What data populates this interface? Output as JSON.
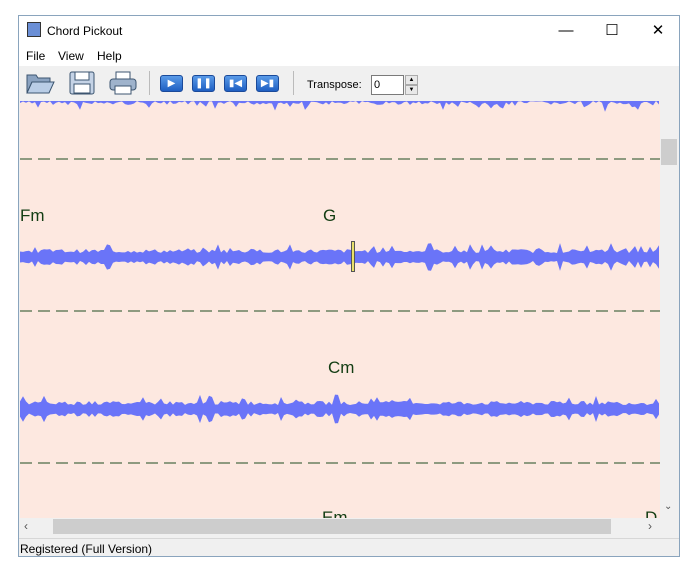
{
  "window": {
    "title": "Chord Pickout",
    "icons": {
      "minimize": "minimize-icon",
      "maximize": "maximize-icon",
      "close": "close-icon"
    }
  },
  "menu": [
    "File",
    "View",
    "Help"
  ],
  "toolbar": {
    "transpose_label": "Transpose:",
    "transpose_value": "0",
    "buttons": [
      "open-folder-icon",
      "save-icon",
      "print-icon",
      "play-icon",
      "pause-icon",
      "previous-icon",
      "next-icon"
    ]
  },
  "chords": [
    {
      "label": "Fm"
    },
    {
      "label": "G"
    },
    {
      "label": "Cm"
    },
    {
      "label": "Em"
    },
    {
      "label": "D"
    }
  ],
  "colors": {
    "background": "#fde8e0",
    "waveform": "#6a74f8",
    "divider": "#1f4d1f",
    "cursor": "#e8e06a"
  },
  "status": "Registered (Full Version)"
}
